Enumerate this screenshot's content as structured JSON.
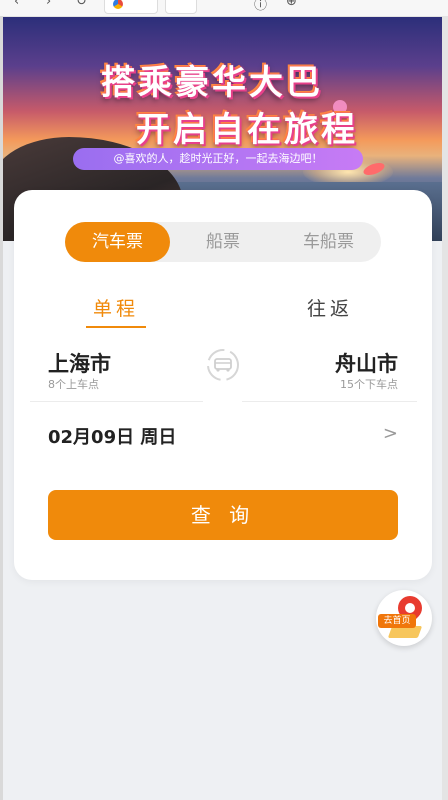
{
  "banner": {
    "title_line1": "搭乘豪华大巴",
    "title_line2": "开启自在旅程",
    "subtitle": "@喜欢的人，趁时光正好，一起去海边吧！"
  },
  "tabs": [
    {
      "label": "汽车票",
      "active": true
    },
    {
      "label": "船票",
      "active": false
    },
    {
      "label": "车船票",
      "active": false
    }
  ],
  "trip_mode": {
    "one_way": "单程",
    "round_trip": "往返",
    "selected": "单程"
  },
  "route": {
    "from_city": "上海市",
    "from_stops": "8个上车点",
    "to_city": "舟山市",
    "to_stops": "15个下车点"
  },
  "date": {
    "value": "02月09日 周日",
    "arrow": ">"
  },
  "query_button": "查 询",
  "home_button": "去首页",
  "colors": {
    "accent": "#f08a0b",
    "background": "#eef0f3"
  }
}
